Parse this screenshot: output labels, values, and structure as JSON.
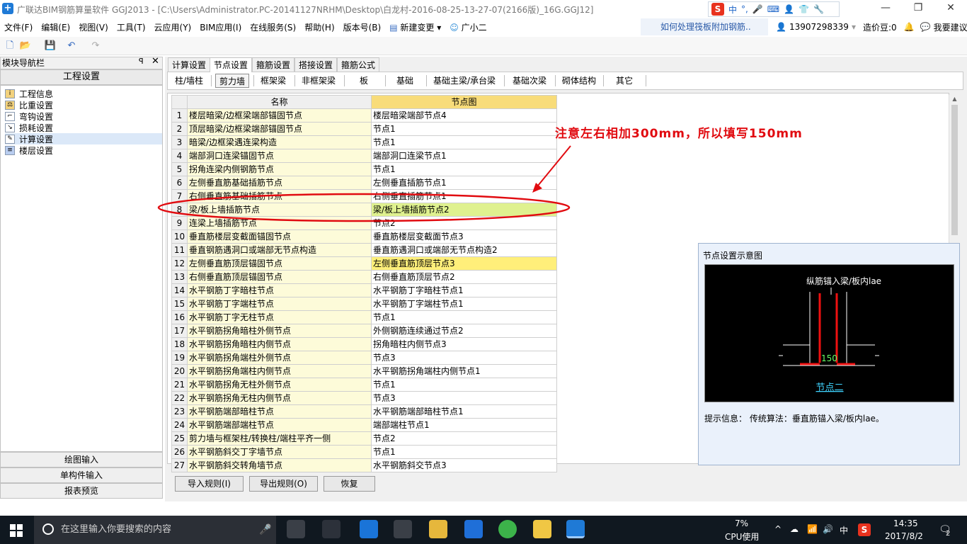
{
  "window": {
    "title": "广联达BIM钢筋算量软件 GGJ2013 - [C:\\Users\\Administrator.PC-20141127NRHM\\Desktop\\白龙村-2016-08-25-13-27-07(2166版)_16G.GGJ12]"
  },
  "ime": {
    "items": [
      "中",
      "°,",
      "🎤",
      "⌨",
      "👤",
      "👕",
      "🔧"
    ]
  },
  "menu": [
    "文件(F)",
    "编辑(E)",
    "视图(V)",
    "工具(T)",
    "云应用(Y)",
    "BIM应用(I)",
    "在线服务(S)",
    "帮助(H)",
    "版本号(B)",
    "新建变更",
    "广小二"
  ],
  "help_link": "如何处理筏板附加钢筋..",
  "user": {
    "phone": "13907298339",
    "points": "造价豆:0",
    "suggest": "我要建议"
  },
  "nav": {
    "title": "模块导航栏",
    "header": "工程设置",
    "items": [
      "工程信息",
      "比重设置",
      "弯钩设置",
      "损耗设置",
      "计算设置",
      "楼层设置"
    ],
    "bottom": [
      "绘图输入",
      "单构件输入",
      "报表预览"
    ]
  },
  "tabs": [
    "计算设置",
    "节点设置",
    "箍筋设置",
    "搭接设置",
    "箍筋公式"
  ],
  "subtabs": [
    "柱/墙柱",
    "剪力墙",
    "框架梁",
    "非框架梁",
    "板",
    "基础",
    "基础主梁/承台梁",
    "基础次梁",
    "砌体结构",
    "其它"
  ],
  "grid": {
    "headers": [
      "名称",
      "节点图"
    ],
    "rows": [
      [
        "1",
        "楼层暗梁/边框梁端部锚固节点",
        "楼层暗梁端部节点4"
      ],
      [
        "2",
        "顶层暗梁/边框梁端部锚固节点",
        "节点1"
      ],
      [
        "3",
        "暗梁/边框梁遇连梁构造",
        "节点1"
      ],
      [
        "4",
        "端部洞口连梁锚固节点",
        "端部洞口连梁节点1"
      ],
      [
        "5",
        "拐角连梁内侧钢筋节点",
        "节点1"
      ],
      [
        "6",
        "左侧垂直筋基础插筋节点",
        "左侧垂直插筋节点1"
      ],
      [
        "7",
        "右侧垂直筋基础插筋节点",
        "右侧垂直插筋节点1"
      ],
      [
        "8",
        "梁/板上墙插筋节点",
        "梁/板上墙插筋节点2"
      ],
      [
        "9",
        "连梁上墙插筋节点",
        "节点2"
      ],
      [
        "10",
        "垂直筋楼层变截面锚固节点",
        "垂直筋楼层变截面节点3"
      ],
      [
        "11",
        "垂直钢筋遇洞口或端部无节点构造",
        "垂直筋遇洞口或端部无节点构造2"
      ],
      [
        "12",
        "左侧垂直筋顶层锚固节点",
        "左侧垂直筋顶层节点3"
      ],
      [
        "13",
        "右侧垂直筋顶层锚固节点",
        "右侧垂直筋顶层节点2"
      ],
      [
        "14",
        "水平钢筋丁字暗柱节点",
        "水平钢筋丁字暗柱节点1"
      ],
      [
        "15",
        "水平钢筋丁字端柱节点",
        "水平钢筋丁字端柱节点1"
      ],
      [
        "16",
        "水平钢筋丁字无柱节点",
        "节点1"
      ],
      [
        "17",
        "水平钢筋拐角暗柱外侧节点",
        "外侧钢筋连续通过节点2"
      ],
      [
        "18",
        "水平钢筋拐角暗柱内侧节点",
        "拐角暗柱内侧节点3"
      ],
      [
        "19",
        "水平钢筋拐角端柱外侧节点",
        "节点3"
      ],
      [
        "20",
        "水平钢筋拐角端柱内侧节点",
        "水平钢筋拐角端柱内侧节点1"
      ],
      [
        "21",
        "水平钢筋拐角无柱外侧节点",
        "节点1"
      ],
      [
        "22",
        "水平钢筋拐角无柱内侧节点",
        "节点3"
      ],
      [
        "23",
        "水平钢筋端部暗柱节点",
        "水平钢筋端部暗柱节点1"
      ],
      [
        "24",
        "水平钢筋端部端柱节点",
        "端部端柱节点1"
      ],
      [
        "25",
        "剪力墙与框架柱/转换柱/端柱平齐一侧",
        "节点2"
      ],
      [
        "26",
        "水平钢筋斜交丁字墙节点",
        "节点1"
      ],
      [
        "27",
        "水平钢筋斜交转角墙节点",
        "水平钢筋斜交节点3"
      ]
    ]
  },
  "annotation": "注意左右相加300mm，所以填写150mm",
  "panel": {
    "title": "节点设置示意图",
    "diagram_label": "纵筋锚入梁/板内lae",
    "diagram_dim": "150",
    "diagram_caption": "节点二",
    "hint": "提示信息：  传统算法：垂直筋锚入梁/板内lae。"
  },
  "buttons": [
    "导入规则(I)",
    "导出规则(O)",
    "恢复"
  ],
  "taskbar": {
    "search_placeholder": "在这里输入你要搜索的内容",
    "cpu_pct": "7%",
    "cpu_label": "CPU使用",
    "ime": "中",
    "time": "14:35",
    "date": "2017/8/2",
    "notify": "2"
  },
  "colors": {
    "highlight_row": "#ffef7a",
    "selected_row": "#dff18f",
    "annotation": "#e10b10",
    "brand": "#1f7ad6"
  }
}
